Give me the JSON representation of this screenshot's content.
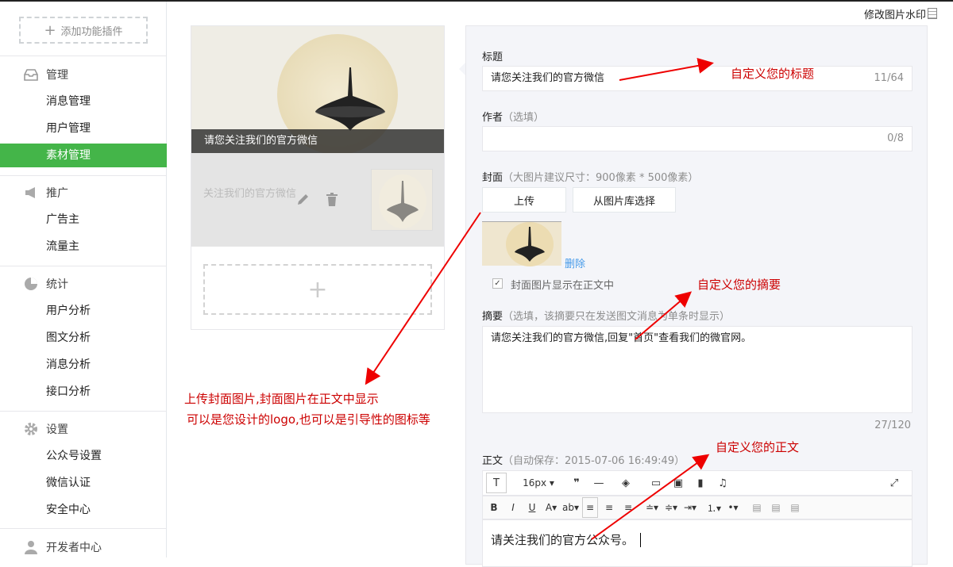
{
  "sidebar": {
    "add_plugin": "添加功能插件",
    "sections": [
      {
        "title": "管理",
        "icon": "inbox-icon",
        "items": [
          "消息管理",
          "用户管理",
          "素材管理"
        ]
      },
      {
        "title": "推广",
        "icon": "megaphone-icon",
        "items": [
          "广告主",
          "流量主"
        ]
      },
      {
        "title": "统计",
        "icon": "pie-chart-icon",
        "items": [
          "用户分析",
          "图文分析",
          "消息分析",
          "接口分析"
        ]
      },
      {
        "title": "设置",
        "icon": "gear-icon",
        "items": [
          "公众号设置",
          "微信认证",
          "安全中心"
        ]
      },
      {
        "title": "开发者中心",
        "icon": "user-icon",
        "items": []
      }
    ],
    "active_item": "素材管理",
    "active_color": "#44b549"
  },
  "header": {
    "watermark": "修改图片水印"
  },
  "preview": {
    "main_title": "请您关注我们的官方微信",
    "sub_title": "关注我们的官方微信"
  },
  "editor": {
    "title_label": "标题",
    "title_value": "请您关注我们的官方微信",
    "title_count": "11/64",
    "author_label": "作者",
    "author_note": "（选填）",
    "author_count": "0/8",
    "cover_label": "封面",
    "cover_note": "（大图片建议尺寸：900像素 * 500像素）",
    "upload_btn": "上传",
    "library_btn": "从图片库选择",
    "delete_link": "删除",
    "show_in_body": "封面图片显示在正文中",
    "summary_label": "摘要",
    "summary_note": "（选填，该摘要只在发送图文消息为单条时显示）",
    "summary_value": "请您关注我们的官方微信,回复\"首页\"查看我们的微官网。",
    "summary_count": "27/120",
    "body_label": "正文",
    "body_note": "（自动保存：2015-07-06 16:49:49）",
    "font_size": "16px",
    "body_value": "请关注我们的官方公众号。"
  },
  "annotations": {
    "title": "自定义您的标题",
    "summary": "自定义您的摘要",
    "body": "自定义您的正文",
    "cover_line1": "上传封面图片,封面图片在正文中显示",
    "cover_line2": "可以是您设计的logo,也可以是引导性的图标等",
    "color": "#cc0000"
  }
}
